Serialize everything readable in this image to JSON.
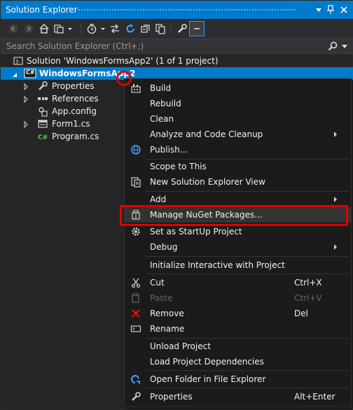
{
  "window": {
    "title": "Solution Explorer"
  },
  "search": {
    "placeholder": "Search Solution Explorer (Ctrl+;)"
  },
  "tree": {
    "solution_label": "Solution 'WindowsFormsApp2' (1 of 1 project)",
    "project_label": "WindowsFormsApp2",
    "project_badge": "C#",
    "items": [
      {
        "label": "Properties",
        "icon": "wrench-icon"
      },
      {
        "label": "References",
        "icon": "references-icon"
      },
      {
        "label": "App.config",
        "icon": "config-file-icon"
      },
      {
        "label": "Form1.cs",
        "icon": "form-icon"
      },
      {
        "label": "Program.cs",
        "icon": "csharp-file-icon"
      }
    ]
  },
  "menu": {
    "build": "Build",
    "rebuild": "Rebuild",
    "clean": "Clean",
    "analyze": "Analyze and Code Cleanup",
    "publish": "Publish...",
    "scope": "Scope to This",
    "new_view": "New Solution Explorer View",
    "add": "Add",
    "manage_nuget": "Manage NuGet Packages...",
    "set_startup": "Set as StartUp Project",
    "debug": "Debug",
    "init_interactive": "Initialize Interactive with Project",
    "cut": "Cut",
    "cut_shortcut": "Ctrl+X",
    "paste": "Paste",
    "paste_shortcut": "Ctrl+V",
    "remove": "Remove",
    "remove_shortcut": "Del",
    "rename": "Rename",
    "unload": "Unload Project",
    "load_deps": "Load Project Dependencies",
    "open_folder": "Open Folder in File Explorer",
    "properties": "Properties",
    "properties_shortcut": "Alt+Enter"
  },
  "colors": {
    "accent": "#007acc",
    "highlight": "#e00000",
    "background": "#252526",
    "menu_background": "#1b1b1c"
  }
}
